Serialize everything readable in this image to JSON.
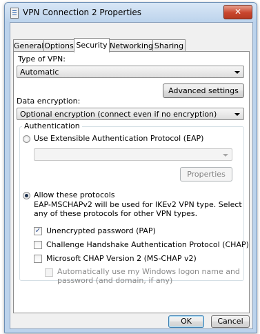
{
  "window": {
    "title": "VPN Connection 2 Properties",
    "close_glyph": "✕"
  },
  "tabs": [
    "General",
    "Options",
    "Security",
    "Networking",
    "Sharing"
  ],
  "security": {
    "type_label": "Type of VPN:",
    "type_value": "Automatic",
    "advanced_button": "Advanced settings",
    "encryption_label": "Data encryption:",
    "encryption_value": "Optional encryption (connect even if no encryption)",
    "auth_group": "Authentication",
    "eap_radio": "Use Extensible Authentication Protocol (EAP)",
    "eap_value": "",
    "properties_button": "Properties",
    "allow_radio": "Allow these protocols",
    "allow_note_line1": "EAP-MSCHAPv2 will be used for IKEv2 VPN type. Select",
    "allow_note_line2": "any of these protocols for other VPN types.",
    "pap": "Unencrypted password (PAP)",
    "chap": "Challenge Handshake Authentication Protocol (CHAP)",
    "mschap": "Microsoft CHAP Version 2 (MS-CHAP v2)",
    "auto_logon_line1": "Automatically use my Windows logon name and",
    "auto_logon_line2": "password (and domain, if any)"
  },
  "buttons": {
    "ok": "OK",
    "cancel": "Cancel"
  },
  "check_glyph": "✓",
  "state": {
    "pap": true,
    "chap": false,
    "mschap": false,
    "auto_logon": false,
    "selected_tab": "Security"
  }
}
